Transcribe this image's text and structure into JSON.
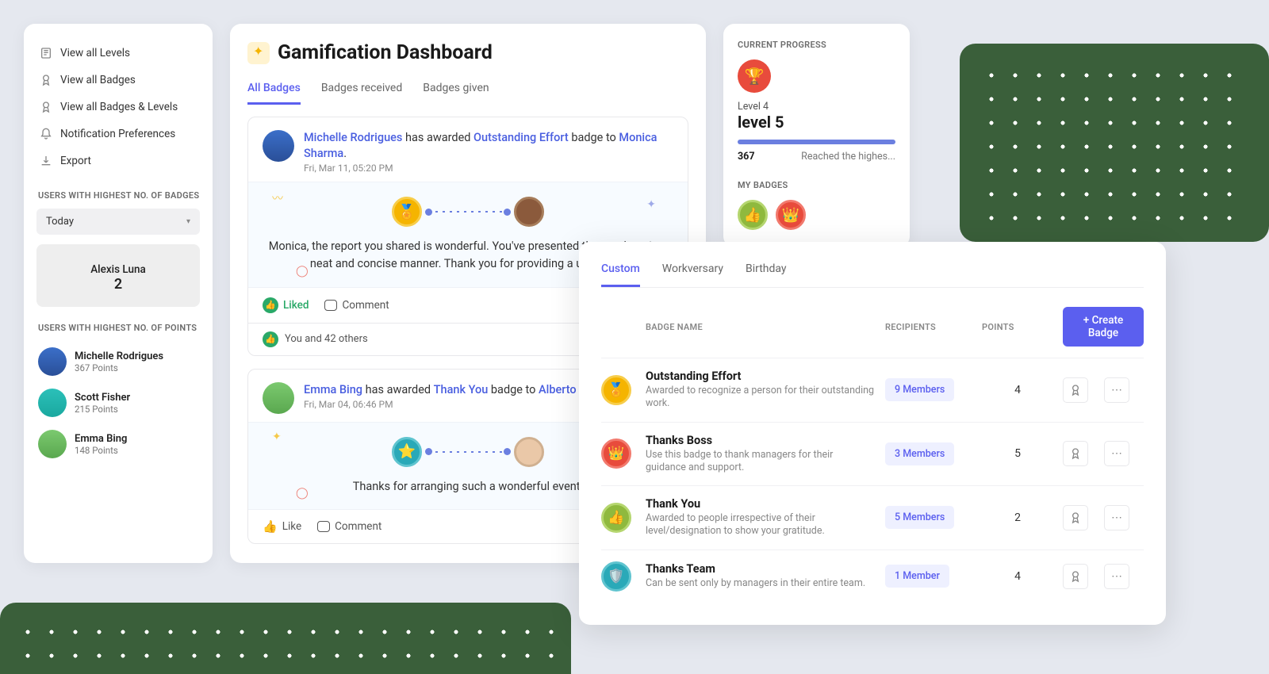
{
  "sidebar": {
    "menu": [
      {
        "label": "View all Levels"
      },
      {
        "label": "View all Badges"
      },
      {
        "label": "View all Badges & Levels"
      },
      {
        "label": "Notification Preferences"
      },
      {
        "label": "Export"
      }
    ],
    "highest_badges": {
      "title": "USERS WITH HIGHEST NO. OF BADGES",
      "dropdown": "Today",
      "top_user": {
        "name": "Alexis Luna",
        "count": "2"
      }
    },
    "highest_points": {
      "title": "USERS WITH HIGHEST NO. OF POINTS",
      "users": [
        {
          "name": "Michelle Rodrigues",
          "pts": "367 Points"
        },
        {
          "name": "Scott Fisher",
          "pts": "215 Points"
        },
        {
          "name": "Emma Bing",
          "pts": "148 Points"
        }
      ]
    }
  },
  "main": {
    "title": "Gamification Dashboard",
    "tabs": [
      {
        "label": "All Badges",
        "active": true
      },
      {
        "label": "Badges received"
      },
      {
        "label": "Badges given"
      }
    ],
    "feed": [
      {
        "awarder": "Michelle Rodrigues",
        "verb": " has awarded ",
        "badge": "Outstanding Effort",
        "mid": " badge to ",
        "recipient": "Monica Sharma",
        "end": ".",
        "time": "Fri, Mar 11, 05:20 PM",
        "msg": "Monica, the report you shared is wonderful. You've presented the numbers in a neat and concise manner. Thank you for providing a unique pe",
        "like_mode": "liked",
        "like_label": "Liked",
        "comment_label": "Comment",
        "likers": "You and 42 others"
      },
      {
        "awarder": "Emma Bing",
        "verb": " has awarded ",
        "badge": "Thank You",
        "mid": " badge to ",
        "recipient": "Alberto Lane",
        "end": ".",
        "time": "Fri, Mar 04, 06:46 PM",
        "msg": "Thanks for arranging such a wonderful event!",
        "like_mode": "like",
        "like_label": "Like",
        "comment_label": "Comment"
      }
    ]
  },
  "progress": {
    "title": "CURRENT PROGRESS",
    "level_sm": "Level 4",
    "level_lg": "level 5",
    "points": "367",
    "note": "Reached the highes...",
    "my_badges_title": "MY BADGES"
  },
  "badge_panel": {
    "tabs": [
      {
        "label": "Custom",
        "active": true
      },
      {
        "label": "Workversary"
      },
      {
        "label": "Birthday"
      }
    ],
    "th_name": "BADGE NAME",
    "th_rec": "RECIPIENTS",
    "th_pts": "POINTS",
    "create_label": "+  Create Badge",
    "rows": [
      {
        "name": "Outstanding Effort",
        "desc": "Awarded to recognize a person for their outstanding work.",
        "members": "9 Members",
        "points": "4",
        "color": "gold"
      },
      {
        "name": "Thanks Boss",
        "desc": "Use this badge to thank managers for their guidance and support.",
        "members": "3 Members",
        "points": "5",
        "color": "red"
      },
      {
        "name": "Thank You",
        "desc": "Awarded to people irrespective of their level/designation to show your gratitude.",
        "members": "5 Members",
        "points": "2",
        "color": "green"
      },
      {
        "name": "Thanks Team",
        "desc": "Can be sent only by managers in their entire team.",
        "members": "1 Member",
        "points": "4",
        "color": "teal"
      }
    ]
  }
}
